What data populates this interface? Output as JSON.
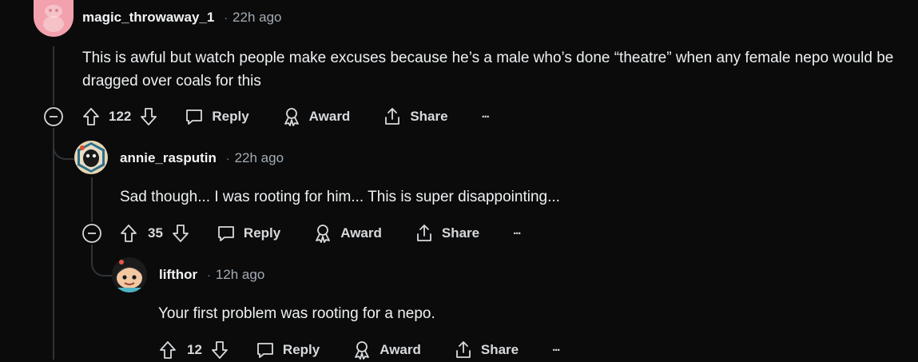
{
  "comments": [
    {
      "author": "magic_throwaway_1",
      "time": "22h ago",
      "body": "This is awful but watch people make excuses because he’s a male who’s done “theatre” when any female nepo would be dragged over coals for this",
      "votes": "122",
      "actions": {
        "reply": "Reply",
        "award": "Award",
        "share": "Share",
        "more": "···"
      }
    },
    {
      "author": "annie_rasputin",
      "time": "22h ago",
      "body": "Sad though... I was rooting for him... This is super disappointing...",
      "votes": "35",
      "actions": {
        "reply": "Reply",
        "award": "Award",
        "share": "Share",
        "more": "···"
      }
    },
    {
      "author": "lifthor",
      "time": "12h ago",
      "body": "Your first problem was rooting for a nepo.",
      "votes": "12",
      "actions": {
        "reply": "Reply",
        "award": "Award",
        "share": "Share",
        "more": "···"
      }
    }
  ],
  "separator": "·",
  "colors": {
    "background": "#0b0b0c",
    "thread_line": "#2f3438",
    "text": "#eef1f2",
    "muted": "#a3acb3"
  }
}
